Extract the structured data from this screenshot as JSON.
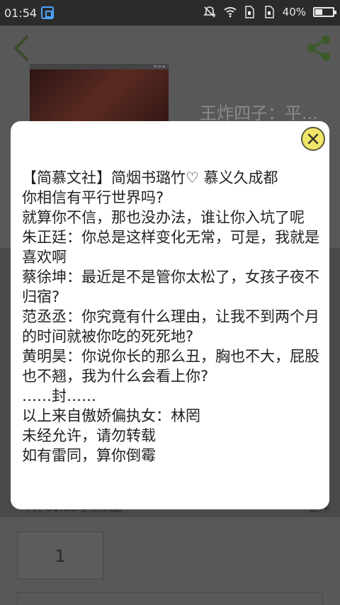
{
  "status_bar": {
    "time": "01:54",
    "battery": "40%",
    "battery_level": 0.4
  },
  "background": {
    "book_title": "王炸四子：平...",
    "update_prefix": "今天",
    "update_time": "01:55",
    "update_suffix": "更新到最",
    "order_label": "正序",
    "chapter_number": "1"
  },
  "dialog": {
    "lines": [
      "【简慕文社】简烟书璐竹♡ 慕义久成都",
      "你相信有平行世界吗?",
      "就算你不信，那也没办法，谁让你入坑了呢",
      "朱正廷：你总是这样变化无常，可是，我就是喜欢啊",
      "蔡徐坤：最近是不是管你太松了，女孩子夜不归宿?",
      "范丞丞：你究竟有什么理由，让我不到两个月的时间就被你吃的死死地?",
      "黄明昊：你说你长的那么丑，胸也不大，屁股也不翘，我为什么会看上你?",
      "……封……",
      "以上来自傲娇偏执女：林罔",
      "未经允许，请勿转载",
      "如有雷同，算你倒霉"
    ]
  },
  "colors": {
    "close_button": "#f2e66a",
    "share_icon": "#3c5a2a",
    "back_icon": "#3c4a2a"
  }
}
